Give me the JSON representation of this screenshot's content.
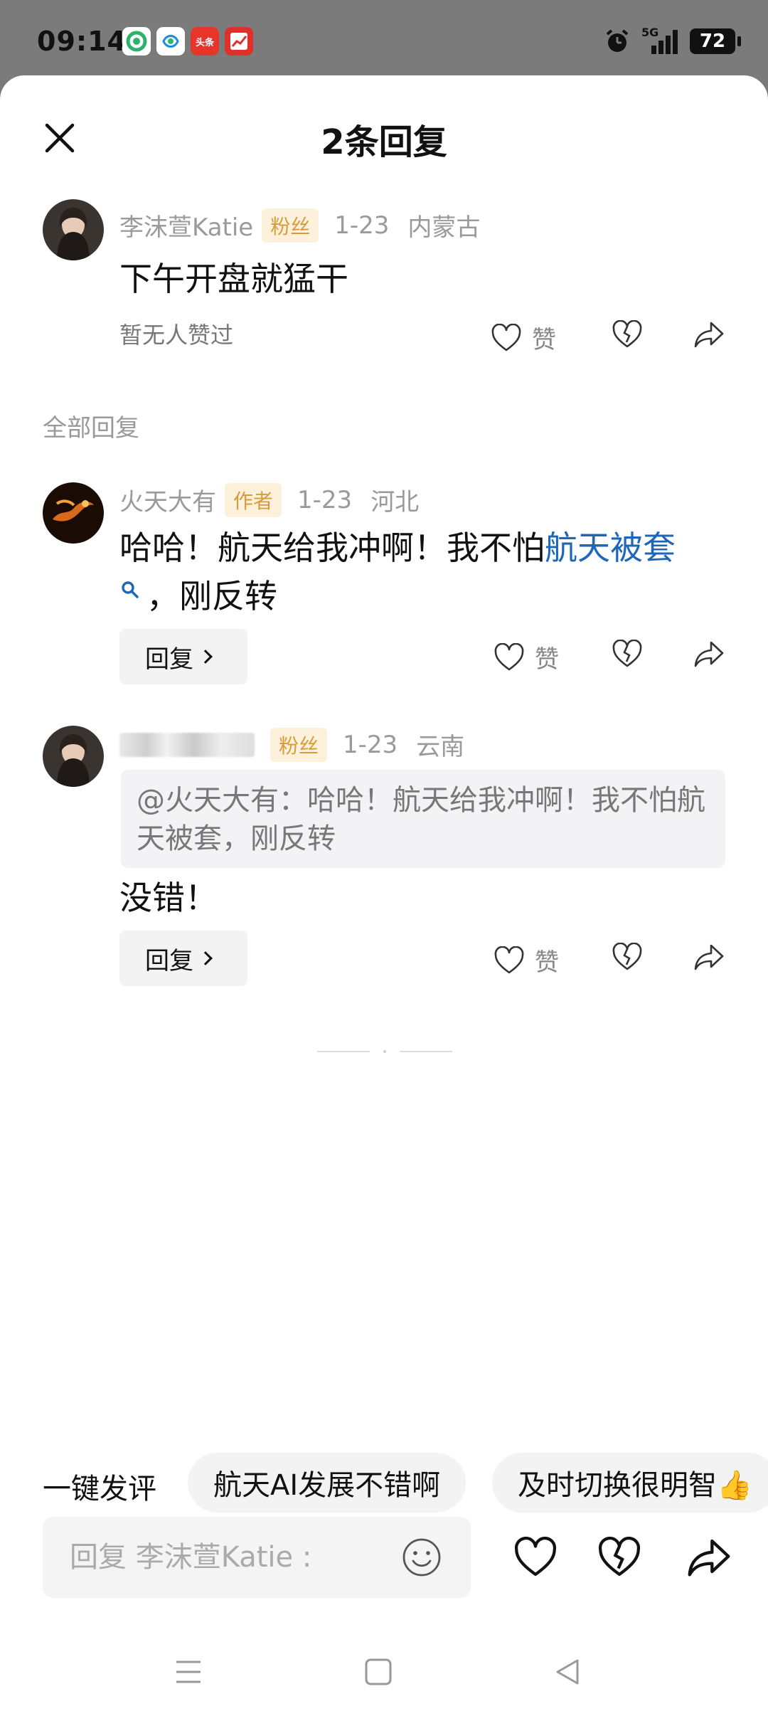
{
  "status_bar": {
    "time": "09:14",
    "app_icons": [
      "360-security-icon",
      "china-mobile-icon",
      "toutiao-icon",
      "stock-app-icon"
    ],
    "toutiao_label": "头条",
    "network": "5G",
    "battery": "72"
  },
  "header": {
    "title": "2条回复"
  },
  "main_comment": {
    "user": "李沫萱Katie",
    "tag": "粉丝",
    "date": "1-23",
    "location": "内蒙古",
    "text": "下午开盘就猛干",
    "like_status": "暂无人赞过",
    "like_label": "赞"
  },
  "section_title": "全部回复",
  "replies": [
    {
      "user": "火天大有",
      "tag": "作者",
      "date": "1-23",
      "location": "河北",
      "text_before": "哈哈！航天给我冲啊！我不怕",
      "link_text": "航天被套",
      "text_after": "，刚反转",
      "reply_label": "回复",
      "like_label": "赞"
    },
    {
      "user": "",
      "tag": "粉丝",
      "date": "1-23",
      "location": "云南",
      "quote": "@火天大有：哈哈！航天给我冲啊！我不怕航天被套，刚反转",
      "text": "没错！",
      "reply_label": "回复",
      "like_label": "赞"
    }
  ],
  "quick_reply": {
    "label": "一键发评",
    "chips": [
      "航天AI发展不错啊",
      "及时切换很明智👍"
    ]
  },
  "input": {
    "placeholder": "回复 李沫萱Katie :"
  },
  "colors": {
    "link": "#1c67b7",
    "tag_bg": "#fdf1dc",
    "tag_text": "#d89b3a"
  }
}
